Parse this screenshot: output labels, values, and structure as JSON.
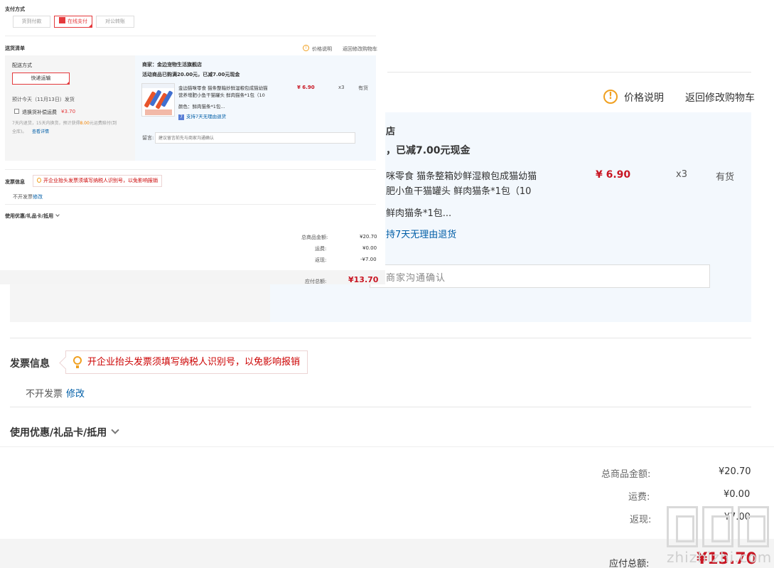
{
  "background": {
    "price_info_label": "价格说明",
    "return_cart_label": "返回修改购物车",
    "shop_suffix": "店",
    "promo_fragment": "，已减7.00元现金",
    "product_title_line1": "咪零食 猫条整箱妙鲜湿粮包成猫幼猫",
    "product_title_line2": "肥小鱼干猫罐头 鲜肉猫条*1包（10",
    "price": "¥ 6.90",
    "qty": "x3",
    "stock": "有货",
    "color_fragment": "鲜肉猫条*1包...",
    "return_policy_fragment": "持7天无理由退货",
    "remark_fragment": "商家沟通确认",
    "invoice_title": "发票信息",
    "invoice_tip": "开企业抬头发票须填写纳税人识别号，以免影响报销",
    "invoice_status": "不开发票",
    "invoice_modify": "修改",
    "coupon_title": "使用优惠/礼品卡/抵用",
    "total_goods_label": "总商品金额:",
    "total_goods_value": "¥20.70",
    "shipping_label": "运费:",
    "shipping_value": "¥0.00",
    "cashback_label": "返现:",
    "cashback_value": "-¥7.00",
    "payable_label": "应付总额:",
    "payable_value": "¥13.70",
    "watermark_text": "zhizhizhi.com"
  },
  "foreground": {
    "payment_title": "支付方式",
    "payment_options": [
      "货到付款",
      "在线支付",
      "对公转账"
    ],
    "delivery_title": "送货清单",
    "price_info_label": "价格说明",
    "return_cart_label": "返回修改购物车",
    "ship_method_title": "配送方式",
    "ship_method_value": "快递运输",
    "eta_text": "预计今天（11月13日）发货",
    "insurance_label": "退换货补偿运费",
    "insurance_price": "¥3.70",
    "insurance_desc_line1_a": "7天内退货，15天内换货，预计获得",
    "insurance_desc_line1_b": "8.00",
    "insurance_desc_line1_c": "元运费赔付(到",
    "insurance_desc_line2": "全库)。",
    "insurance_details_link": "查看详情",
    "merchant_label": "商家：金边宠物生活旗舰店",
    "promo_text": "活动商品已购满20.00元，已减7.00元现金",
    "product_title_line1": "金边猫咪零食 猫条整箱妙鲜湿粮包成猫幼猫",
    "product_title_line2": "营养增肥小鱼干猫罐头 鲜肉猫条*1包（10",
    "price": "¥ 6.90",
    "qty": "x3",
    "stock": "有货",
    "color_text": "颜色：鲜肉猫条*1包...",
    "return_badge": "7",
    "return_policy": "支持7天无理由退货",
    "remark_label": "留言:",
    "remark_placeholder": "建议留言前先与商家沟通确认",
    "invoice_title": "发票信息",
    "invoice_tip": "开企业抬头发票须填写纳税人识别号，以免影响报销",
    "invoice_status": "不开发票",
    "invoice_modify": "修改",
    "coupon_title": "使用优惠/礼品卡/抵用",
    "total_goods_label": "总商品金额:",
    "total_goods_value": "¥20.70",
    "shipping_label": "运费:",
    "shipping_value": "¥0.00",
    "cashback_label": "返现:",
    "cashback_value": "-¥7.00",
    "payable_label": "应付总额:",
    "payable_value": "¥13.70"
  },
  "colors": {
    "accent_red": "#e4393c",
    "price_red": "#c81623",
    "link_blue": "#005ea7",
    "info_orange": "#f0a020"
  }
}
